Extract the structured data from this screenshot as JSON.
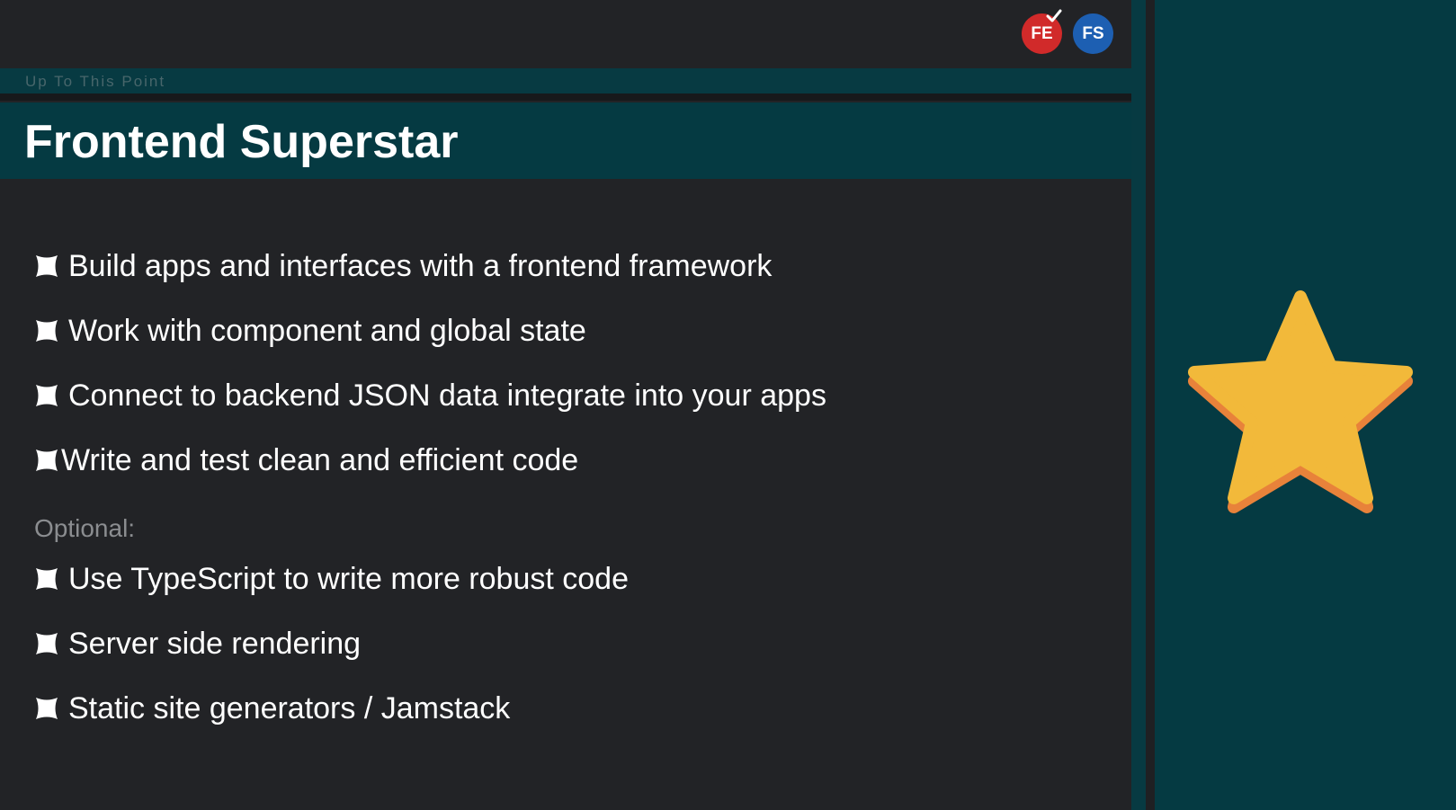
{
  "header": {
    "badges": [
      {
        "label": "FE",
        "color": "#d12a2a",
        "icon": "check-icon"
      },
      {
        "label": "FS",
        "color": "#1d5fb2"
      }
    ]
  },
  "section": {
    "label": "Up To This Point"
  },
  "title": "Frontend Superstar",
  "bullets": [
    "Build apps and interfaces with a frontend framework",
    "Work with component and global state",
    "Connect to backend JSON data integrate into your apps",
    "Write and test clean and efficient code"
  ],
  "optional": {
    "label": "Optional:",
    "items": [
      "Use TypeScript to write more robust code",
      "Server side rendering",
      "Static site generators / Jamstack"
    ]
  },
  "colors": {
    "background": "#222326",
    "teal": "#053a42",
    "star": "#f2b93a",
    "star_shadow": "#e8823a"
  },
  "icons": {
    "bullet": "bullet-square-icon",
    "feature": "star-icon"
  }
}
